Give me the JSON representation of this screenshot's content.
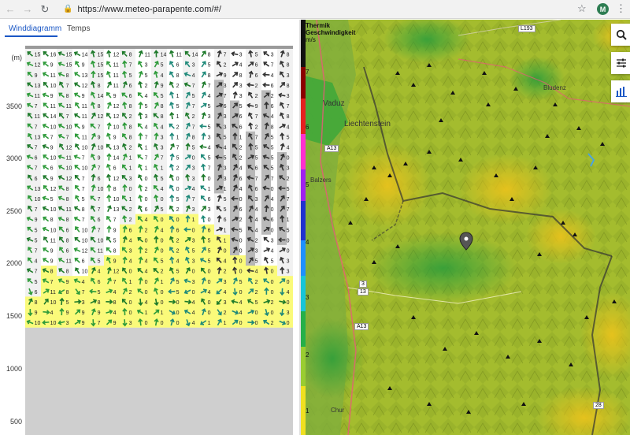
{
  "browser": {
    "url": "https://www.meteo-parapente.com/#/",
    "profile_initial": "M"
  },
  "tabs": [
    {
      "label": "Winddiagramm",
      "active": true
    },
    {
      "label": "Temps",
      "active": false
    }
  ],
  "diagram": {
    "unit": "(m)",
    "altitudes": [
      "3500",
      "3000",
      "2500",
      "2000",
      "1500",
      "1000",
      "500"
    ],
    "columns": 17,
    "rows": 27,
    "first_row_speeds": [
      "15",
      "16",
      "15",
      "14",
      "15",
      "12",
      "8",
      "11",
      "14",
      "11",
      "14",
      "8",
      "7",
      "3",
      "5",
      "3",
      "8"
    ]
  },
  "map": {
    "legend_title_1": "Thermik",
    "legend_title_2": "Geschwindigkeit",
    "legend_unit": "m/s",
    "scale_labels": [
      "7",
      "6",
      "5",
      "4",
      "3",
      "2",
      "1"
    ],
    "towns": [
      "Vaduz",
      "Liechtenstein",
      "Balzers",
      "Bludenz",
      "Chur"
    ],
    "roads": [
      "L193",
      "A13",
      "A13",
      "3",
      "13",
      "28"
    ]
  },
  "colors": {
    "accent": "#1a57c5",
    "map_green": "#9bb833",
    "thermal_yellow": "#e6c21a",
    "weak_green": "#3aa83a",
    "diagram_yellow": "#fafa7a"
  }
}
